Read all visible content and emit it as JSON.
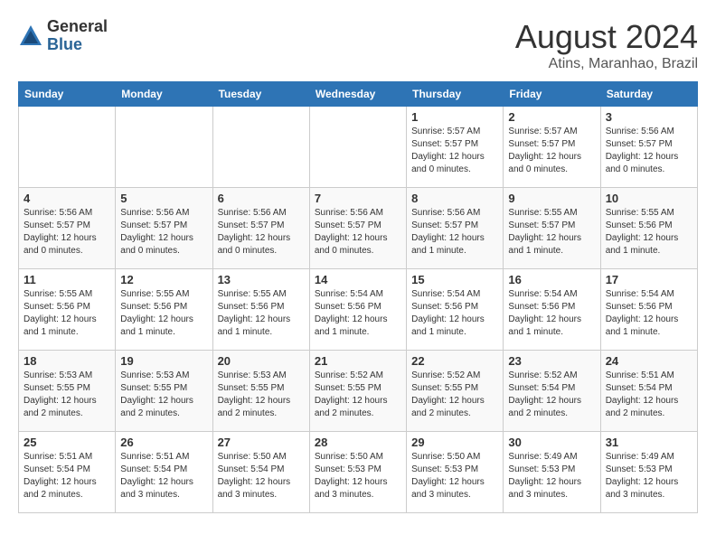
{
  "header": {
    "logo_general": "General",
    "logo_blue": "Blue",
    "title": "August 2024",
    "subtitle": "Atins, Maranhao, Brazil"
  },
  "days_of_week": [
    "Sunday",
    "Monday",
    "Tuesday",
    "Wednesday",
    "Thursday",
    "Friday",
    "Saturday"
  ],
  "weeks": [
    [
      {
        "day": "",
        "info": ""
      },
      {
        "day": "",
        "info": ""
      },
      {
        "day": "",
        "info": ""
      },
      {
        "day": "",
        "info": ""
      },
      {
        "day": "1",
        "info": "Sunrise: 5:57 AM\nSunset: 5:57 PM\nDaylight: 12 hours and 0 minutes."
      },
      {
        "day": "2",
        "info": "Sunrise: 5:57 AM\nSunset: 5:57 PM\nDaylight: 12 hours and 0 minutes."
      },
      {
        "day": "3",
        "info": "Sunrise: 5:56 AM\nSunset: 5:57 PM\nDaylight: 12 hours and 0 minutes."
      }
    ],
    [
      {
        "day": "4",
        "info": "Sunrise: 5:56 AM\nSunset: 5:57 PM\nDaylight: 12 hours and 0 minutes."
      },
      {
        "day": "5",
        "info": "Sunrise: 5:56 AM\nSunset: 5:57 PM\nDaylight: 12 hours and 0 minutes."
      },
      {
        "day": "6",
        "info": "Sunrise: 5:56 AM\nSunset: 5:57 PM\nDaylight: 12 hours and 0 minutes."
      },
      {
        "day": "7",
        "info": "Sunrise: 5:56 AM\nSunset: 5:57 PM\nDaylight: 12 hours and 0 minutes."
      },
      {
        "day": "8",
        "info": "Sunrise: 5:56 AM\nSunset: 5:57 PM\nDaylight: 12 hours and 1 minute."
      },
      {
        "day": "9",
        "info": "Sunrise: 5:55 AM\nSunset: 5:57 PM\nDaylight: 12 hours and 1 minute."
      },
      {
        "day": "10",
        "info": "Sunrise: 5:55 AM\nSunset: 5:56 PM\nDaylight: 12 hours and 1 minute."
      }
    ],
    [
      {
        "day": "11",
        "info": "Sunrise: 5:55 AM\nSunset: 5:56 PM\nDaylight: 12 hours and 1 minute."
      },
      {
        "day": "12",
        "info": "Sunrise: 5:55 AM\nSunset: 5:56 PM\nDaylight: 12 hours and 1 minute."
      },
      {
        "day": "13",
        "info": "Sunrise: 5:55 AM\nSunset: 5:56 PM\nDaylight: 12 hours and 1 minute."
      },
      {
        "day": "14",
        "info": "Sunrise: 5:54 AM\nSunset: 5:56 PM\nDaylight: 12 hours and 1 minute."
      },
      {
        "day": "15",
        "info": "Sunrise: 5:54 AM\nSunset: 5:56 PM\nDaylight: 12 hours and 1 minute."
      },
      {
        "day": "16",
        "info": "Sunrise: 5:54 AM\nSunset: 5:56 PM\nDaylight: 12 hours and 1 minute."
      },
      {
        "day": "17",
        "info": "Sunrise: 5:54 AM\nSunset: 5:56 PM\nDaylight: 12 hours and 1 minute."
      }
    ],
    [
      {
        "day": "18",
        "info": "Sunrise: 5:53 AM\nSunset: 5:55 PM\nDaylight: 12 hours and 2 minutes."
      },
      {
        "day": "19",
        "info": "Sunrise: 5:53 AM\nSunset: 5:55 PM\nDaylight: 12 hours and 2 minutes."
      },
      {
        "day": "20",
        "info": "Sunrise: 5:53 AM\nSunset: 5:55 PM\nDaylight: 12 hours and 2 minutes."
      },
      {
        "day": "21",
        "info": "Sunrise: 5:52 AM\nSunset: 5:55 PM\nDaylight: 12 hours and 2 minutes."
      },
      {
        "day": "22",
        "info": "Sunrise: 5:52 AM\nSunset: 5:55 PM\nDaylight: 12 hours and 2 minutes."
      },
      {
        "day": "23",
        "info": "Sunrise: 5:52 AM\nSunset: 5:54 PM\nDaylight: 12 hours and 2 minutes."
      },
      {
        "day": "24",
        "info": "Sunrise: 5:51 AM\nSunset: 5:54 PM\nDaylight: 12 hours and 2 minutes."
      }
    ],
    [
      {
        "day": "25",
        "info": "Sunrise: 5:51 AM\nSunset: 5:54 PM\nDaylight: 12 hours and 2 minutes."
      },
      {
        "day": "26",
        "info": "Sunrise: 5:51 AM\nSunset: 5:54 PM\nDaylight: 12 hours and 3 minutes."
      },
      {
        "day": "27",
        "info": "Sunrise: 5:50 AM\nSunset: 5:54 PM\nDaylight: 12 hours and 3 minutes."
      },
      {
        "day": "28",
        "info": "Sunrise: 5:50 AM\nSunset: 5:53 PM\nDaylight: 12 hours and 3 minutes."
      },
      {
        "day": "29",
        "info": "Sunrise: 5:50 AM\nSunset: 5:53 PM\nDaylight: 12 hours and 3 minutes."
      },
      {
        "day": "30",
        "info": "Sunrise: 5:49 AM\nSunset: 5:53 PM\nDaylight: 12 hours and 3 minutes."
      },
      {
        "day": "31",
        "info": "Sunrise: 5:49 AM\nSunset: 5:53 PM\nDaylight: 12 hours and 3 minutes."
      }
    ]
  ]
}
